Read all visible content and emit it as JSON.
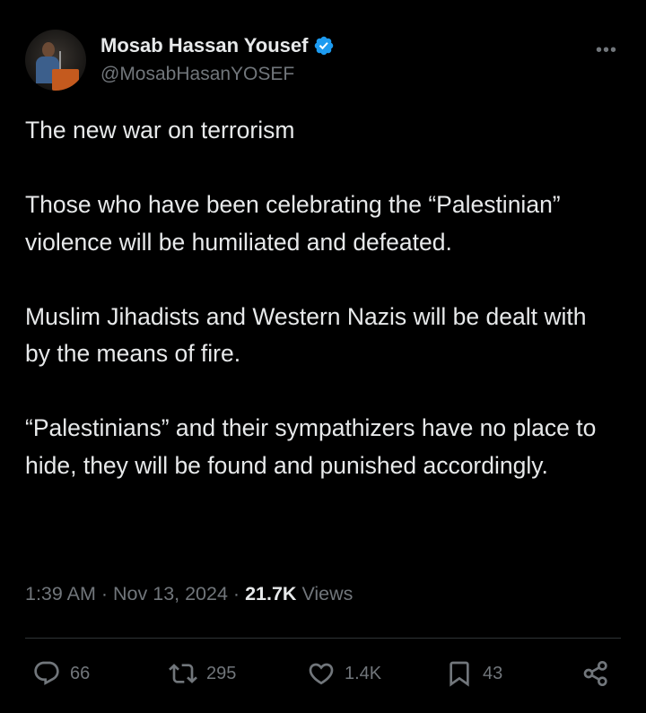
{
  "author": {
    "name": "Mosab Hassan Yousef",
    "handle": "@MosabHasanYOSEF"
  },
  "tweet": {
    "text": "The new war on terrorism\n\nThose who have been celebrating the “Palestinian” violence will be humiliated and defeated.\n\nMuslim Jihadists and Western Nazis will be dealt with by the means of fire.\n\n“Palestinians” and their sympathizers have no place to hide, they will be found and punished accordingly."
  },
  "meta": {
    "time": "1:39 AM",
    "date": "Nov 13, 2024",
    "separator": "·",
    "views_count": "21.7K",
    "views_label": "Views"
  },
  "actions": {
    "replies": "66",
    "reposts": "295",
    "likes": "1.4K",
    "bookmarks": "43"
  },
  "colors": {
    "background": "#000000",
    "text": "#e7e9ea",
    "secondary": "#71767b",
    "verified": "#1d9bf0",
    "divider": "#2f3336"
  },
  "icons": {
    "verified": "verified-badge-icon",
    "more": "more-options-icon",
    "reply": "reply-icon",
    "repost": "repost-icon",
    "like": "heart-icon",
    "bookmark": "bookmark-icon",
    "share": "share-icon"
  }
}
